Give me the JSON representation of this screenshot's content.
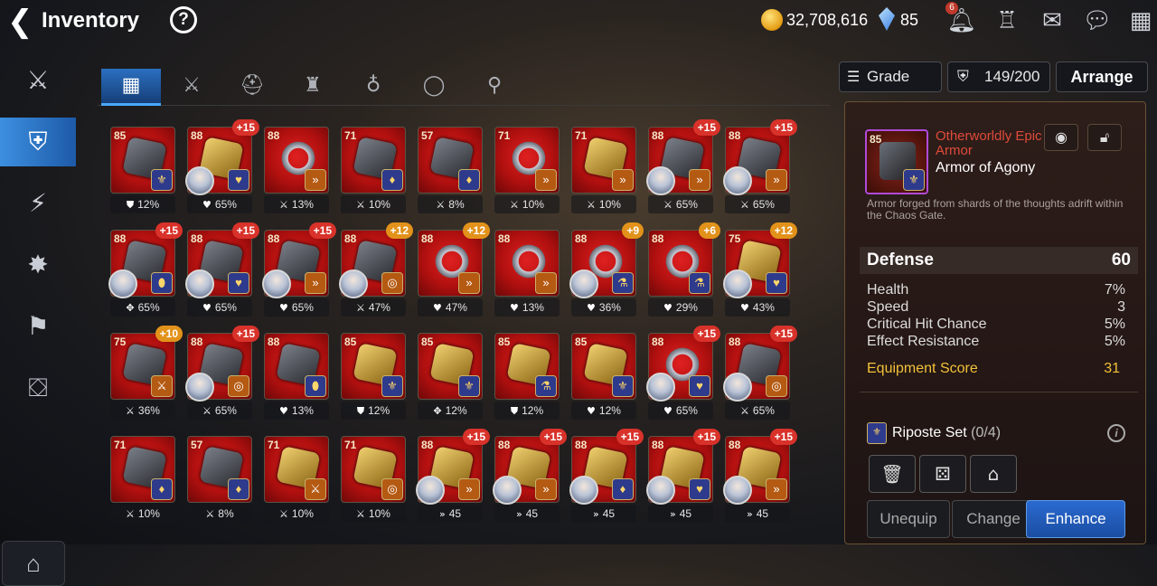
{
  "header": {
    "back_icon": "back-arrow-icon",
    "title": "Inventory",
    "help_label": "?",
    "gold": "32,708,616",
    "crystals": "85",
    "notification_count": "6"
  },
  "tabs": [
    {
      "name": "tab-all",
      "icon": "grid-icon",
      "glyph": "▦"
    },
    {
      "name": "tab-weapon",
      "icon": "sword-icon",
      "glyph": "⚔"
    },
    {
      "name": "tab-helmet",
      "icon": "helmet-icon",
      "glyph": "⛑"
    },
    {
      "name": "tab-armor",
      "icon": "armor-icon",
      "glyph": "♜"
    },
    {
      "name": "tab-necklace",
      "icon": "necklace-icon",
      "glyph": "♁"
    },
    {
      "name": "tab-ring",
      "icon": "ring-icon",
      "glyph": "◯"
    },
    {
      "name": "tab-boots",
      "icon": "boots-icon",
      "glyph": "⚲"
    }
  ],
  "controls": {
    "grade_label": "Grade",
    "capacity": "149/200",
    "arrange_label": "Arrange"
  },
  "items": [
    {
      "lvl": "85",
      "enh": "",
      "stat": "12%",
      "si": "⛊",
      "art": "",
      "set": "⚜",
      "avatar": false
    },
    {
      "lvl": "88",
      "enh": "+15",
      "stat": "65%",
      "si": "♥",
      "art": "gold",
      "set": "♥",
      "avatar": true
    },
    {
      "lvl": "88",
      "enh": "",
      "stat": "13%",
      "si": "⚔",
      "art": "ring",
      "set": "»",
      "avatar": false,
      "orange": true
    },
    {
      "lvl": "71",
      "enh": "",
      "stat": "10%",
      "si": "⚔",
      "art": "",
      "set": "♦",
      "avatar": false
    },
    {
      "lvl": "57",
      "enh": "",
      "stat": "8%",
      "si": "⚔",
      "art": "",
      "set": "♦",
      "avatar": false
    },
    {
      "lvl": "71",
      "enh": "",
      "stat": "10%",
      "si": "⚔",
      "art": "ring",
      "set": "»",
      "avatar": false,
      "orange": true
    },
    {
      "lvl": "71",
      "enh": "",
      "stat": "10%",
      "si": "⚔",
      "art": "gold",
      "set": "»",
      "avatar": false,
      "orange": true
    },
    {
      "lvl": "88",
      "enh": "+15",
      "stat": "65%",
      "si": "⚔",
      "art": "",
      "set": "»",
      "avatar": true,
      "orange": true
    },
    {
      "lvl": "88",
      "enh": "+15",
      "stat": "65%",
      "si": "⚔",
      "art": "",
      "set": "»",
      "avatar": true,
      "orange": true
    },
    {
      "lvl": "88",
      "enh": "+15",
      "stat": "65%",
      "si": "✥",
      "art": "",
      "set": "⬮",
      "avatar": true
    },
    {
      "lvl": "88",
      "enh": "+15",
      "stat": "65%",
      "si": "♥",
      "art": "",
      "set": "♥",
      "avatar": true
    },
    {
      "lvl": "88",
      "enh": "+15",
      "stat": "65%",
      "si": "♥",
      "art": "",
      "set": "»",
      "avatar": true,
      "orange": true
    },
    {
      "lvl": "88",
      "enh": "+12",
      "stat": "47%",
      "si": "⚔",
      "art": "",
      "set": "◎",
      "avatar": true,
      "orange": true,
      "yellow": true
    },
    {
      "lvl": "88",
      "enh": "+12",
      "stat": "47%",
      "si": "♥",
      "art": "ring",
      "set": "»",
      "avatar": false,
      "orange": true,
      "yellow": true
    },
    {
      "lvl": "88",
      "enh": "",
      "stat": "13%",
      "si": "♥",
      "art": "ring",
      "set": "»",
      "avatar": false,
      "orange": true
    },
    {
      "lvl": "88",
      "enh": "+9",
      "stat": "36%",
      "si": "♥",
      "art": "ring",
      "set": "⚗",
      "avatar": true,
      "yellow": true
    },
    {
      "lvl": "88",
      "enh": "+6",
      "stat": "29%",
      "si": "♥",
      "art": "ring",
      "set": "⚗",
      "avatar": false,
      "yellow": true
    },
    {
      "lvl": "75",
      "enh": "+12",
      "stat": "43%",
      "si": "♥",
      "art": "gold",
      "set": "♥",
      "avatar": true,
      "yellow": true
    },
    {
      "lvl": "75",
      "enh": "+10",
      "stat": "36%",
      "si": "⚔",
      "art": "",
      "set": "⚔",
      "avatar": false,
      "orange": true,
      "yellow": true
    },
    {
      "lvl": "88",
      "enh": "+15",
      "stat": "65%",
      "si": "⚔",
      "art": "",
      "set": "◎",
      "avatar": true,
      "orange": true
    },
    {
      "lvl": "88",
      "enh": "",
      "stat": "13%",
      "si": "♥",
      "art": "",
      "set": "⬮",
      "avatar": false
    },
    {
      "lvl": "85",
      "enh": "",
      "stat": "12%",
      "si": "⛊",
      "art": "gold",
      "set": "⚜",
      "avatar": false
    },
    {
      "lvl": "85",
      "enh": "",
      "stat": "12%",
      "si": "✥",
      "art": "gold",
      "set": "⚜",
      "avatar": false
    },
    {
      "lvl": "85",
      "enh": "",
      "stat": "12%",
      "si": "⛊",
      "art": "gold",
      "set": "⚗",
      "avatar": false
    },
    {
      "lvl": "85",
      "enh": "",
      "stat": "12%",
      "si": "♥",
      "art": "gold",
      "set": "⚜",
      "avatar": false
    },
    {
      "lvl": "88",
      "enh": "+15",
      "stat": "65%",
      "si": "♥",
      "art": "ring",
      "set": "♥",
      "avatar": true
    },
    {
      "lvl": "88",
      "enh": "+15",
      "stat": "65%",
      "si": "⚔",
      "art": "",
      "set": "◎",
      "avatar": true,
      "orange": true
    },
    {
      "lvl": "71",
      "enh": "",
      "stat": "10%",
      "si": "⚔",
      "art": "",
      "set": "♦",
      "avatar": false
    },
    {
      "lvl": "57",
      "enh": "",
      "stat": "8%",
      "si": "⚔",
      "art": "",
      "set": "♦",
      "avatar": false
    },
    {
      "lvl": "71",
      "enh": "",
      "stat": "10%",
      "si": "⚔",
      "art": "gold",
      "set": "⚔",
      "avatar": false,
      "orange": true
    },
    {
      "lvl": "71",
      "enh": "",
      "stat": "10%",
      "si": "⚔",
      "art": "gold",
      "set": "◎",
      "avatar": false,
      "orange": true
    },
    {
      "lvl": "88",
      "enh": "+15",
      "stat": "45",
      "si": "»",
      "art": "gold",
      "set": "»",
      "avatar": true,
      "orange": true
    },
    {
      "lvl": "88",
      "enh": "+15",
      "stat": "45",
      "si": "»",
      "art": "gold",
      "set": "»",
      "avatar": true,
      "orange": true
    },
    {
      "lvl": "88",
      "enh": "+15",
      "stat": "45",
      "si": "»",
      "art": "gold",
      "set": "♦",
      "avatar": true
    },
    {
      "lvl": "88",
      "enh": "+15",
      "stat": "45",
      "si": "»",
      "art": "gold",
      "set": "♥",
      "avatar": true
    },
    {
      "lvl": "88",
      "enh": "+15",
      "stat": "45",
      "si": "»",
      "art": "gold",
      "set": "»",
      "avatar": true,
      "orange": true
    }
  ],
  "detail": {
    "lvl": "85",
    "grade": "Otherworldly Epic Armor",
    "name": "Armor of Agony",
    "description": "Armor forged from shards of the thoughts adrift within the Chaos Gate.",
    "main_stat": {
      "label": "Defense",
      "value": "60"
    },
    "substats": [
      {
        "label": "Health",
        "value": "7%"
      },
      {
        "label": "Speed",
        "value": "3"
      },
      {
        "label": "Critical Hit Chance",
        "value": "5%"
      },
      {
        "label": "Effect Resistance",
        "value": "5%"
      }
    ],
    "score": {
      "label": "Equipment Score",
      "value": "31"
    },
    "set_label": "Riposte Set",
    "set_count": "(0/4)",
    "buttons": {
      "unequip": "Unequip",
      "change": "Change",
      "enhance": "Enhance"
    }
  },
  "colors": {
    "accent": "#2a6ad0",
    "gold_text": "#f2c13a",
    "epic": "#e04a3a",
    "badge": "#d8322a"
  }
}
